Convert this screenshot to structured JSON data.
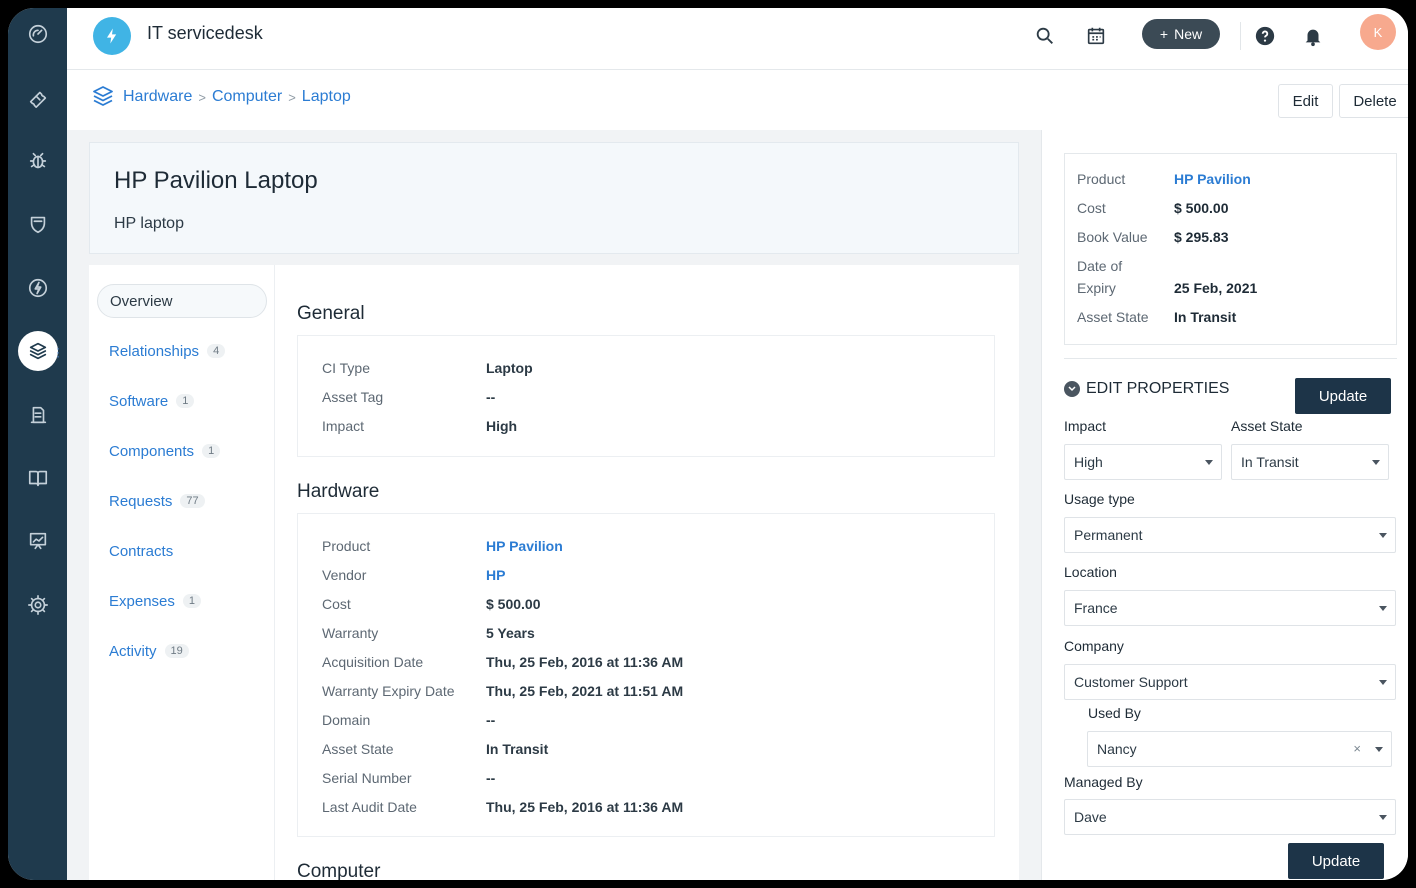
{
  "app": {
    "title": "IT servicedesk",
    "avatar_initial": "K",
    "new_button": "New"
  },
  "sidebar": {
    "items": [
      "dashboard-icon",
      "ticket-icon",
      "bug-icon",
      "shield-icon",
      "lightning-icon",
      "assets-icon",
      "reports-icon",
      "book-icon",
      "analytics-icon",
      "gear-icon"
    ]
  },
  "breadcrumb": {
    "items": [
      "Hardware",
      "Computer",
      "Laptop"
    ],
    "sep": ">"
  },
  "actions": {
    "edit": "Edit",
    "delete": "Delete"
  },
  "asset": {
    "title": "HP Pavilion Laptop",
    "subtitle": "HP laptop"
  },
  "tabs": [
    {
      "label": "Overview",
      "count": ""
    },
    {
      "label": "Relationships",
      "count": "4"
    },
    {
      "label": "Software",
      "count": "1"
    },
    {
      "label": "Components",
      "count": "1"
    },
    {
      "label": "Requests",
      "count": "77"
    },
    {
      "label": "Contracts",
      "count": ""
    },
    {
      "label": "Expenses",
      "count": "1"
    },
    {
      "label": "Activity",
      "count": "19"
    }
  ],
  "general": {
    "title": "General",
    "rows": [
      {
        "k": "CI Type",
        "v": "Laptop"
      },
      {
        "k": "Asset Tag",
        "v": "--"
      },
      {
        "k": "Impact",
        "v": "High"
      }
    ]
  },
  "hardware": {
    "title": "Hardware",
    "rows": [
      {
        "k": "Product",
        "v": "HP Pavilion"
      },
      {
        "k": "Vendor",
        "v": "HP"
      },
      {
        "k": "Cost",
        "v": "$ 500.00"
      },
      {
        "k": "Warranty",
        "v": "5 Years"
      },
      {
        "k": "Acquisition Date",
        "v": "Thu, 25 Feb, 2016 at 11:36 AM"
      },
      {
        "k": "Warranty Expiry Date",
        "v": "Thu, 25 Feb, 2021 at 11:51 AM"
      },
      {
        "k": "Domain",
        "v": "--"
      },
      {
        "k": "Asset State",
        "v": "In Transit"
      },
      {
        "k": "Serial Number",
        "v": "--"
      },
      {
        "k": "Last Audit Date",
        "v": "Thu, 25 Feb, 2016 at 11:36 AM"
      }
    ]
  },
  "computer": {
    "title": "Computer"
  },
  "summary": {
    "product_k": "Product",
    "product_v": "HP Pavilion",
    "cost_k": "Cost",
    "cost_v": "$ 500.00",
    "book_k": "Book Value",
    "book_v": "$ 295.83",
    "expiry_k1": "Date of",
    "expiry_k2": "Expiry",
    "expiry_v": "25 Feb, 2021",
    "state_k": "Asset State",
    "state_v": "In Transit"
  },
  "edit_properties": {
    "title": "EDIT PROPERTIES",
    "update": "Update",
    "impact_label": "Impact",
    "impact_value": "High",
    "asset_state_label": "Asset State",
    "asset_state_value": "In Transit",
    "usage_label": "Usage type",
    "usage_value": "Permanent",
    "location_label": "Location",
    "location_value": "France",
    "company_label": "Company",
    "company_value": "Customer Support",
    "used_by_label": "Used By",
    "used_by_value": "Nancy",
    "managed_by_label": "Managed By",
    "managed_by_value": "Dave",
    "clear_glyph": "×"
  },
  "colors": {
    "sidebar": "#1f3a4d",
    "link": "#2b7cd3",
    "primary_button": "#1d3448",
    "logo": "#40b4e5"
  }
}
